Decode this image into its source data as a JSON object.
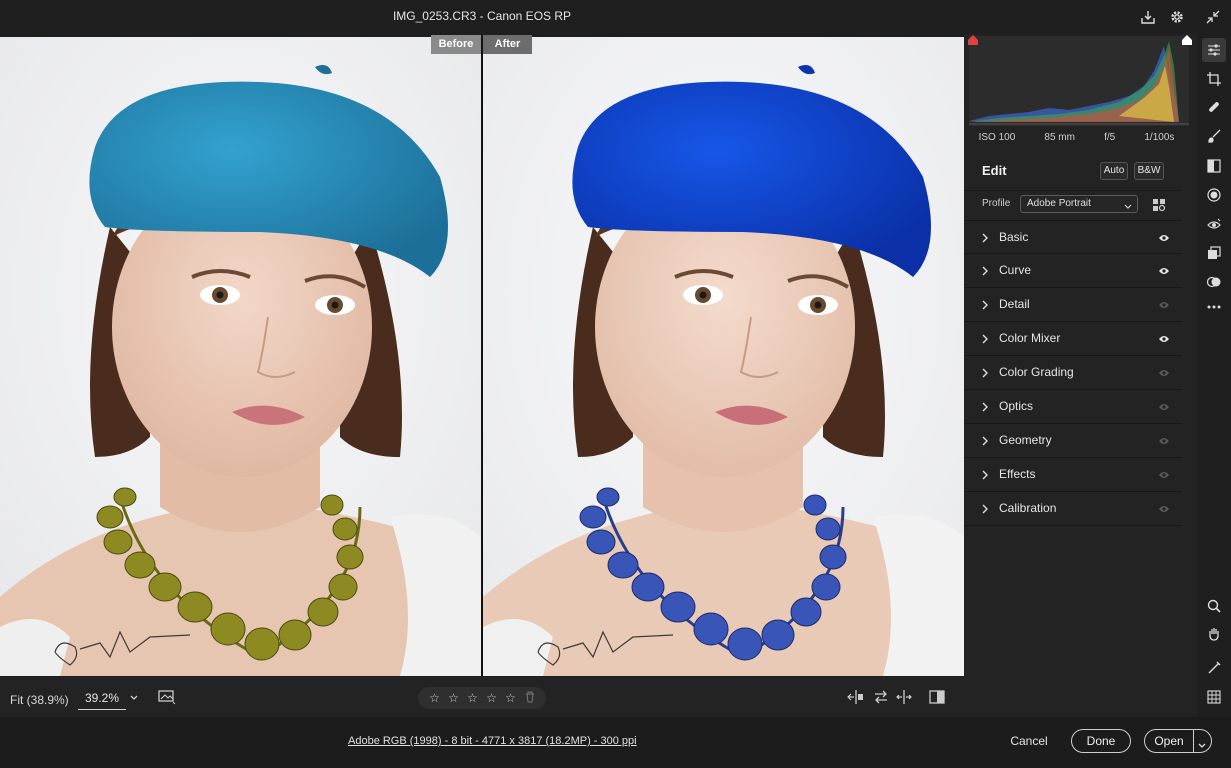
{
  "window": {
    "title": "IMG_0253.CR3  -  Canon EOS RP"
  },
  "titlebar_icons": [
    "save-icon",
    "gear-icon",
    "collapse-icon"
  ],
  "viewer": {
    "before_label": "Before",
    "after_label": "After"
  },
  "bottom_toolbar": {
    "fit_label": "Fit (38.9%)",
    "zoom_value": "39.2%",
    "rating": {
      "stars": 5,
      "filled": 0
    },
    "icons": [
      "image-overlay-icon",
      "left-right-split-icon",
      "swap-icon",
      "copy-settings-icon",
      "toggle-view-icon"
    ]
  },
  "status": {
    "file_info": "Adobe RGB (1998) - 8 bit - 4771 x 3817 (18.2MP) - 300 ppi",
    "cancel": "Cancel",
    "done": "Done",
    "open": "Open"
  },
  "histogram": {
    "exif": {
      "iso": "ISO 100",
      "focal": "85 mm",
      "aperture": "f/5",
      "shutter": "1/100s"
    }
  },
  "edit_panel": {
    "title": "Edit",
    "auto_btn": "Auto",
    "bw_btn": "B&W",
    "profile_label": "Profile",
    "profile_value": "Adobe Portrait",
    "sections": [
      {
        "label": "Basic",
        "visible": true
      },
      {
        "label": "Curve",
        "visible": true
      },
      {
        "label": "Detail",
        "visible": false
      },
      {
        "label": "Color Mixer",
        "visible": true
      },
      {
        "label": "Color Grading",
        "visible": false
      },
      {
        "label": "Optics",
        "visible": false
      },
      {
        "label": "Geometry",
        "visible": false
      },
      {
        "label": "Effects",
        "visible": false
      },
      {
        "label": "Calibration",
        "visible": false
      }
    ]
  },
  "tools": [
    "edit-sliders-icon",
    "crop-icon",
    "healing-icon",
    "brush-icon",
    "gradient-icon",
    "radial-icon",
    "redeye-icon",
    "snapshots-icon",
    "presets-icon",
    "more-icon",
    "zoom-icon",
    "hand-icon",
    "color-sampler-icon",
    "grid-icon"
  ],
  "colors": {
    "before_hat": "#2a8fc0",
    "after_hat": "#1043d6",
    "before_beads": "#8a8a1e",
    "after_beads": "#3050b0",
    "panel_bg": "#232323"
  }
}
